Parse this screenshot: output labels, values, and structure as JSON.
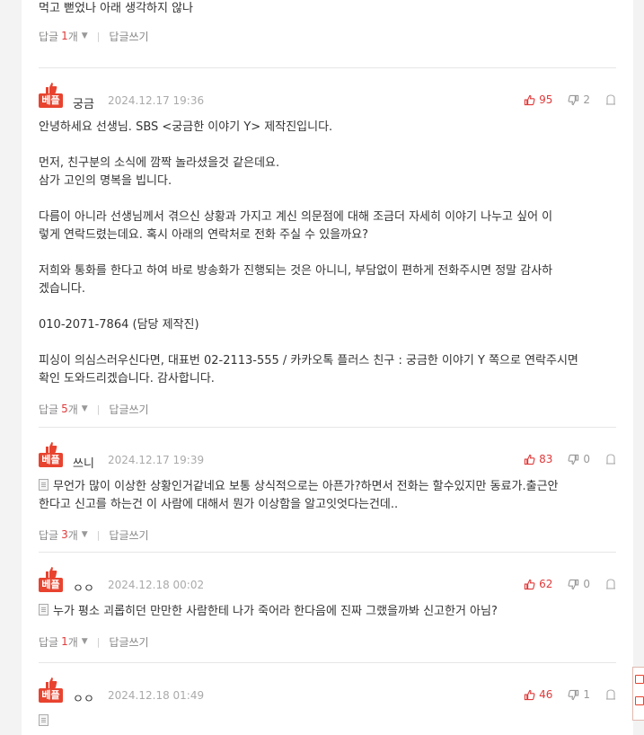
{
  "top_comment_tail": {
    "body_lines": [
      "먹고 뻗었나 아래 생각하지 않나"
    ],
    "reply_label": "답글",
    "reply_count": "1",
    "reply_unit": "개",
    "write_reply_label": "답글쓰기"
  },
  "badge_label": "베플",
  "comments": [
    {
      "nickname": "궁금",
      "date": "2024.12.17 19:36",
      "upvotes": "95",
      "downvotes": "2",
      "has_doc_icon": false,
      "body_lines": [
        "안녕하세요 선생님. SBS <궁금한 이야기 Y> 제작진입니다.",
        "",
        "먼저, 친구분의 소식에 깜짝 놀라셨을것 같은데요.",
        "삼가 고인의 명복을 빕니다.",
        "",
        "다름이 아니라 선생님께서 겪으신 상황과 가지고 계신 의문점에 대해 조금더 자세히 이야기 나누고 싶어 이",
        "렇게 연락드렸는데요. 혹시 아래의 연락처로 전화 주실 수 있을까요?",
        "",
        "저희와 통화를 한다고 하여 바로 방송화가 진행되는 것은 아니니, 부담없이 편하게 전화주시면 정말 감사하",
        "겠습니다.",
        "",
        "010-2071-7864 (담당 제작진)",
        "",
        "피싱이 의심스러우신다면, 대표번 02-2113-555 / 카카오톡 플러스 친구 : 궁금한 이야기 Y 쪽으로 연락주시면",
        "확인 도와드리겠습니다. 감사합니다."
      ],
      "reply_label": "답글",
      "reply_count": "5",
      "reply_unit": "개",
      "write_reply_label": "답글쓰기"
    },
    {
      "nickname": "쓰니",
      "date": "2024.12.17 19:39",
      "upvotes": "83",
      "downvotes": "0",
      "has_doc_icon": true,
      "body_lines": [
        "무언가 많이 이상한 상황인거같네요 보통 상식적으로는 아픈가?하면서 전화는 할수있지만 동료가.출근안",
        "한다고 신고를 하는건 이 사람에 대해서 뭔가 이상함을 알고잇엇다는건데.."
      ],
      "reply_label": "답글",
      "reply_count": "3",
      "reply_unit": "개",
      "write_reply_label": "답글쓰기"
    },
    {
      "nickname": "ㅇㅇ",
      "date": "2024.12.18 00:02",
      "upvotes": "62",
      "downvotes": "0",
      "has_doc_icon": true,
      "body_lines": [
        "누가 평소 괴롭히던 만만한 사람한테 나가 죽어라 한다음에 진짜 그랬을까봐 신고한거 아님?"
      ],
      "reply_label": "답글",
      "reply_count": "1",
      "reply_unit": "개",
      "write_reply_label": "답글쓰기"
    },
    {
      "nickname": "ㅇㅇ",
      "date": "2024.12.18 01:49",
      "upvotes": "46",
      "downvotes": "1",
      "has_doc_icon": true,
      "body_lines": [],
      "reply_label": "",
      "reply_count": "",
      "reply_unit": "",
      "write_reply_label": ""
    }
  ],
  "colors": {
    "accent_red": "#e8432f",
    "upvote_red": "#e03a3a",
    "muted_gray": "#999999"
  }
}
